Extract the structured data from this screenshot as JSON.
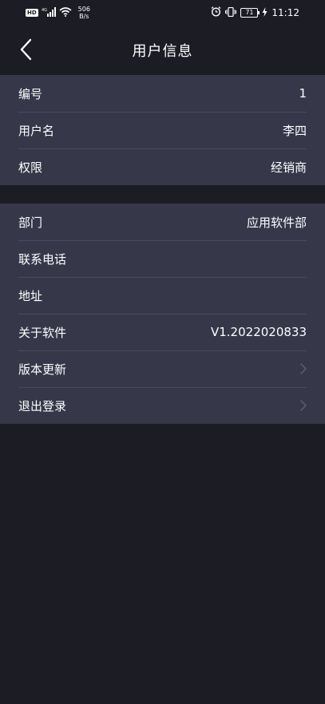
{
  "status_bar": {
    "hd": "HD",
    "signal_gen": "4G",
    "net_speed_value": "506",
    "net_speed_unit": "B/s",
    "battery": "71",
    "time": "11:12"
  },
  "nav": {
    "title": "用户信息"
  },
  "user_info": {
    "rows": [
      {
        "label": "编号",
        "value": "1"
      },
      {
        "label": "用户名",
        "value": "李四"
      },
      {
        "label": "权限",
        "value": "经销商"
      }
    ]
  },
  "details": {
    "rows": [
      {
        "label": "部门",
        "value": "应用软件部"
      },
      {
        "label": "联系电话",
        "value": ""
      },
      {
        "label": "地址",
        "value": ""
      },
      {
        "label": "关于软件",
        "value": "V1.2022020833"
      },
      {
        "label": "版本更新",
        "value": ""
      },
      {
        "label": "退出登录",
        "value": ""
      }
    ]
  },
  "icons": {
    "back": "chevron-left-icon",
    "row_arrow": "chevron-right-icon"
  },
  "colors": {
    "background": "#1c1c25",
    "group_background": "#363749",
    "divider": "#4a4b5d",
    "text": "#ffffff",
    "chevron": "#5f6072"
  }
}
